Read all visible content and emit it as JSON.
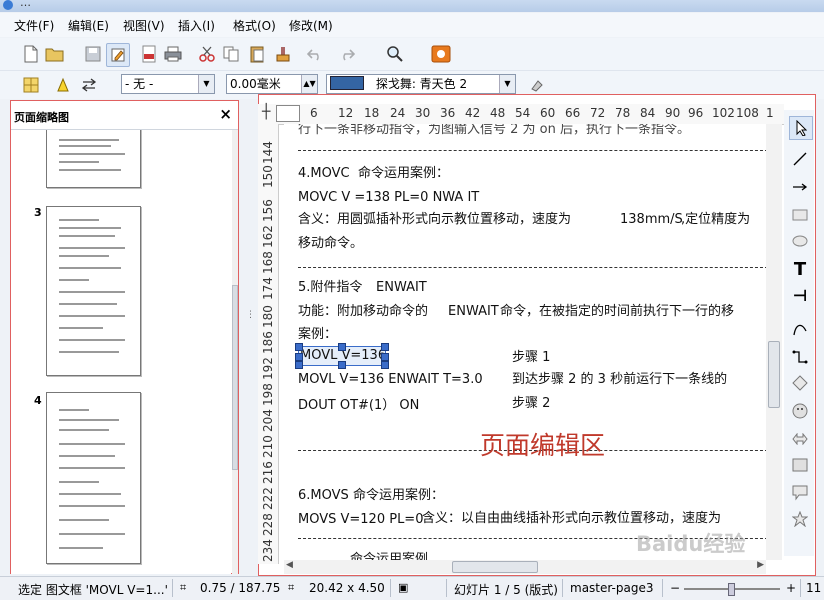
{
  "window": {
    "title_fragment": "…"
  },
  "menu": [
    "文件(F)",
    "编辑(E)",
    "视图(V)",
    "插入(I)",
    "格式(O)",
    "修改(M)"
  ],
  "toolbar2": {
    "line_style": "- 无 -",
    "line_width": "0.00毫米",
    "fill_color": "探戈舞: 青天色 2",
    "fill_color_hex": "#3465a4"
  },
  "left_panel": {
    "title": "页面缩略图",
    "close": "×",
    "pages": [
      "3",
      "4"
    ]
  },
  "ruler": {
    "h_ticks": [
      "6",
      "12",
      "18",
      "24",
      "30",
      "36",
      "42",
      "48",
      "54",
      "60",
      "66",
      "72",
      "78",
      "84",
      "90",
      "96",
      "102",
      "108",
      "1"
    ],
    "v_ticks": [
      "144",
      "138",
      "150",
      "156",
      "162",
      "168",
      "174",
      "180",
      "186",
      "192",
      "198",
      "204",
      "210",
      "216",
      "222",
      "228",
      "234"
    ]
  },
  "doc": {
    "top_cut": "行下一条非移动指令，为图输入信号 2 为 on 后，执行下一条指令。",
    "sec4_title": "4.MOVC",
    "sec4_title2": "命令运用案例：",
    "sec4_cmd": "MOVC    V =138      PL=0     NWA IT",
    "sec4_desc": "含义：用圆弧插补形式向示教位置移动，速度为",
    "sec4_speed": "138mm/S",
    "sec4_desc2": ",定位精度为",
    "sec4_line2": "移动命令。",
    "sec5_title": "5.附件指令",
    "sec5_kw": "ENWAIT",
    "sec5_func": "功能：附加移动命令的",
    "sec5_func2": "命令，在被指定的时间前执行下一行的移",
    "sec5_case": "案例：",
    "row1_left": "MOVL V=136",
    "row1_right": "步骤 1",
    "row2_left": "MOVL V=136 ENWAIT T=3.0",
    "row2_right": "到达步骤 2 的 3 秒前运行下一条线的",
    "row3_left": "DOUT OT#(1） ON",
    "row3_right": "步骤 2",
    "sec6_title": "6.MOVS",
    "sec6_title2": "命令运用案例：",
    "sec6_cmd": "MOVS V=120 PL=0",
    "sec6_desc": "含义：以自由曲线插补形式向示教位置移动，速度为",
    "bottom_cut": "命令运用案例",
    "overlay_label": "页面编辑区"
  },
  "status": {
    "selection": "选定 图文框 'MOVL V=1...'",
    "position": "0.75 / 187.75",
    "size": "20.42 x 4.50",
    "slide": "幻灯片 1 / 5 (版式)",
    "master": "master-page3",
    "zoom_minus": "−",
    "zoom_plus": "+",
    "zoom_value": "11"
  },
  "watermark": "Baidu经验"
}
